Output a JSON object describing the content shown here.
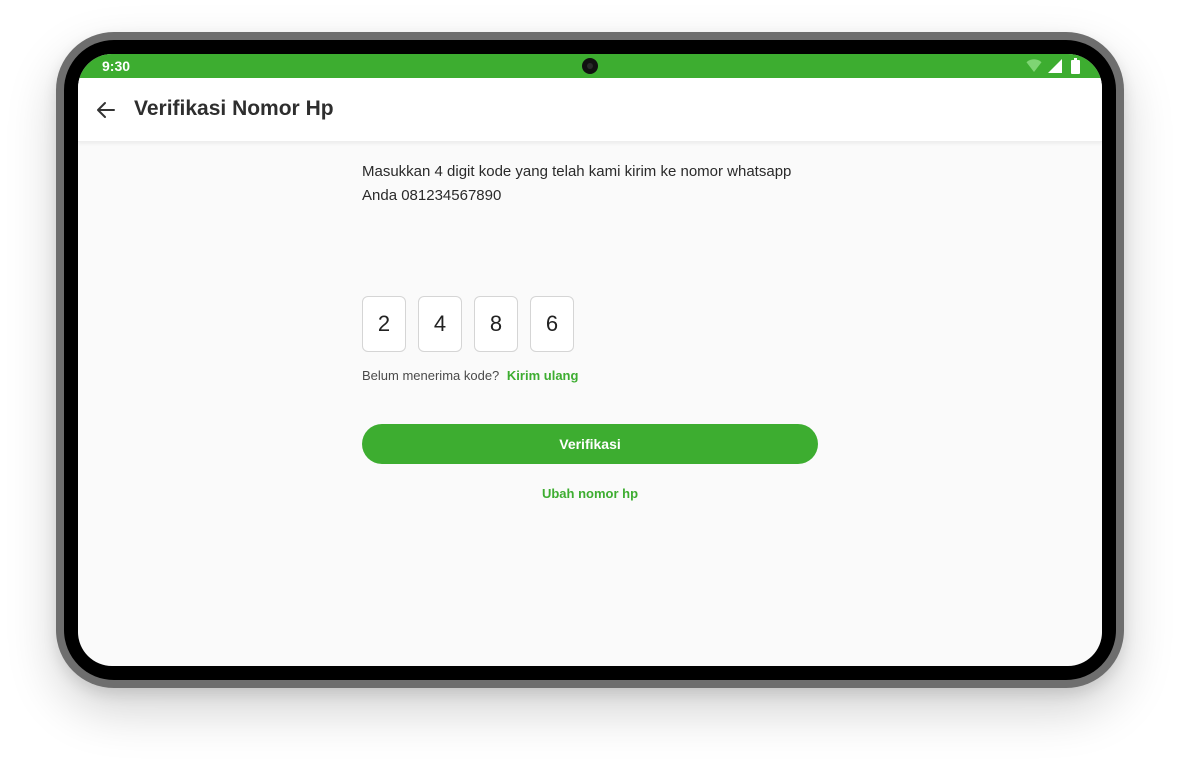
{
  "status_bar": {
    "time": "9:30",
    "icons": [
      "wifi-icon",
      "signal-icon",
      "battery-icon"
    ]
  },
  "app_bar": {
    "back_icon": "arrow-left-icon",
    "title": "Verifikasi Nomor Hp"
  },
  "verification": {
    "instruction_line1": "Masukkan 4 digit kode yang telah kami kirim ke nomor whatsapp",
    "instruction_line2": "Anda 081234567890",
    "otp_digits": [
      "2",
      "4",
      "8",
      "6"
    ],
    "resend_prompt": "Belum menerima kode?",
    "resend_link": "Kirim ulang",
    "verify_button": "Verifikasi",
    "change_number_link": "Ubah nomor hp"
  },
  "colors": {
    "accent": "#3dad30",
    "background": "#fafafa",
    "text": "#2a2a2a"
  }
}
